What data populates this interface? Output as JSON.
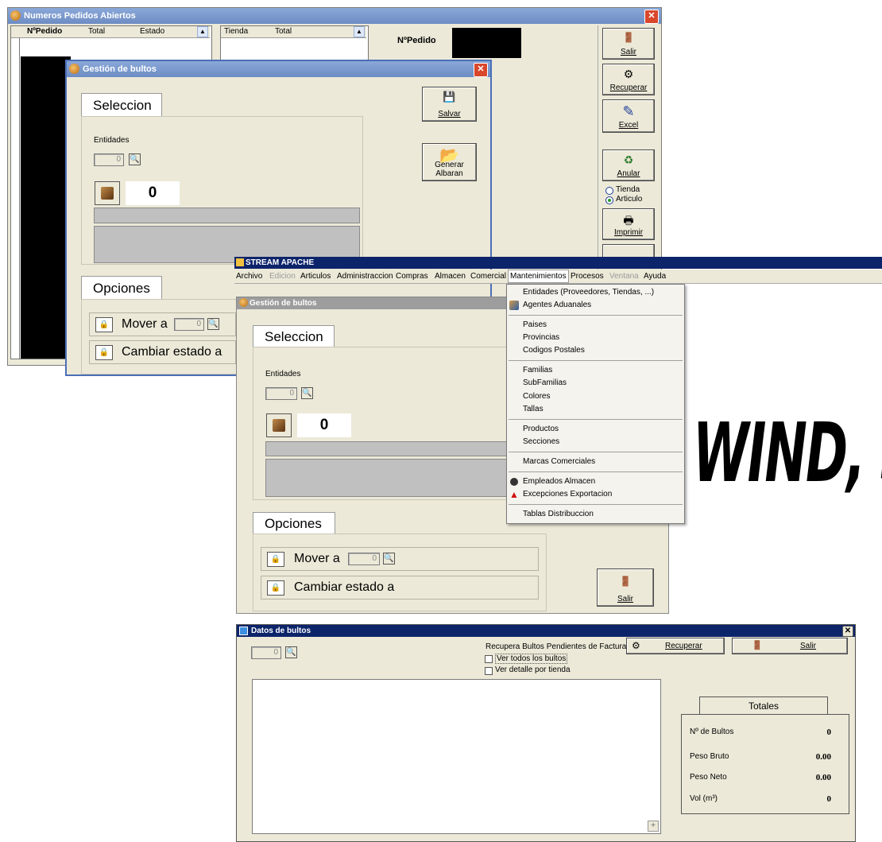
{
  "win1": {
    "title": "Numeros Pedidos Abiertos",
    "close": "✕",
    "col_headers": [
      "NºPedido",
      "Total",
      "Estado",
      "Tienda",
      "Total"
    ],
    "npedido_label": "NºPedido",
    "buttons": [
      {
        "label": "Salir",
        "icon": "exit-door-icon",
        "glyph": "🚪"
      },
      {
        "label": "Recuperar",
        "icon": "recover-gears-icon",
        "glyph": "⚙"
      },
      {
        "label": "Excel",
        "icon": "excel-icon",
        "glyph": "✎"
      },
      {
        "label": "Anular",
        "icon": "recycle-bin-icon",
        "glyph": "♻"
      },
      {
        "label": "Imprimir",
        "icon": "printer-icon",
        "glyph": "🖶"
      }
    ],
    "radio_tienda": "Tienda",
    "radio_articulo": "Articulo"
  },
  "win2": {
    "title": "Gestión de bultos",
    "close": "✕",
    "seleccion_tab": "Seleccion",
    "entidades_label": "Entidades",
    "entidades_value": "0",
    "count_value": "0",
    "salvar_label": "Salvar",
    "generar_label": "Generar Albaran",
    "opciones_tab": "Opciones",
    "mover_label": "Mover a",
    "mover_value": "0",
    "cambiar_label": "Cambiar estado a"
  },
  "app": {
    "title": "STREAM APACHE",
    "menu": [
      "Archivo",
      "Edicion",
      "Articulos",
      "Administraccion",
      "Compras",
      "Almacen",
      "Comercial",
      "Mantenimientos",
      "Procesos",
      "Ventana",
      "Ayuda"
    ],
    "dropdown": [
      "Entidades (Proveedores, Tiendas, ...)",
      "Agentes Aduanales",
      "Paises",
      "Provincias",
      "Codigos Postales",
      "Familias",
      "SubFamilias",
      "Colores",
      "Tallas",
      "Productos",
      "Secciones",
      "Marcas Comerciales",
      "Empleados Almacen",
      "Excepciones Exportacion",
      "Tablas Distribuccion"
    ]
  },
  "win3": {
    "title": "Gestión de bultos",
    "seleccion_tab": "Seleccion",
    "entidades_label": "Entidades",
    "entidades_value": "0",
    "count_value": "0",
    "opciones_tab": "Opciones",
    "mover_label": "Mover a",
    "mover_value": "0",
    "cambiar_label": "Cambiar estado a",
    "salir_label": "Salir"
  },
  "logo_text": "WIND, S.A.",
  "win4": {
    "title": "Datos de bultos",
    "close": "✕",
    "field_value": "0",
    "recupera_label": "Recupera Bultos Pendientes de Facturar",
    "recuperar_btn": "Recuperar",
    "salir_btn": "Salir",
    "ver_todos": "Ver todos los bultos",
    "ver_detalle": "Ver detalle por tienda",
    "totales_title": "Totales",
    "totales": [
      {
        "label": "Nº de Bultos",
        "value": "0"
      },
      {
        "label": "Peso Bruto",
        "value": "0.00"
      },
      {
        "label": "Peso Neto",
        "value": "0.00"
      },
      {
        "label": "Vol (m³)",
        "value": "0"
      }
    ]
  }
}
